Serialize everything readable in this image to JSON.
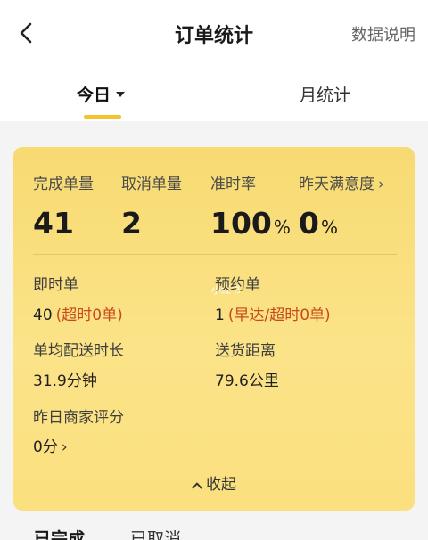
{
  "header": {
    "title": "订单统计",
    "help_label": "数据说明"
  },
  "tabs": [
    {
      "label": "今日",
      "active": true
    },
    {
      "label": "月统计",
      "active": false
    }
  ],
  "summary": {
    "stats": [
      {
        "label": "完成单量",
        "value": "41",
        "unit": ""
      },
      {
        "label": "取消单量",
        "value": "2",
        "unit": ""
      },
      {
        "label": "准时率",
        "value": "100",
        "unit": "%"
      },
      {
        "label": "昨天满意度",
        "value": "0",
        "unit": "%"
      }
    ],
    "instant": {
      "label": "即时单",
      "value": "40",
      "note": "(超时0单)"
    },
    "scheduled": {
      "label": "预约单",
      "value": "1",
      "note": "(早达/超时0单)"
    },
    "avg_time": {
      "label": "单均配送时长",
      "value": "31.9分钟"
    },
    "distance": {
      "label": "送货距离",
      "value": "79.6公里"
    },
    "merchant_rating": {
      "label": "昨日商家评分",
      "value": "0分"
    },
    "watermark": "小红书",
    "collapse_label": "收起"
  },
  "bottom_tabs": [
    {
      "label": "已完成"
    },
    {
      "label": "已取消"
    }
  ],
  "colors": {
    "accent": "#f4c430",
    "card": "#fbe388",
    "note": "#c8491c"
  }
}
